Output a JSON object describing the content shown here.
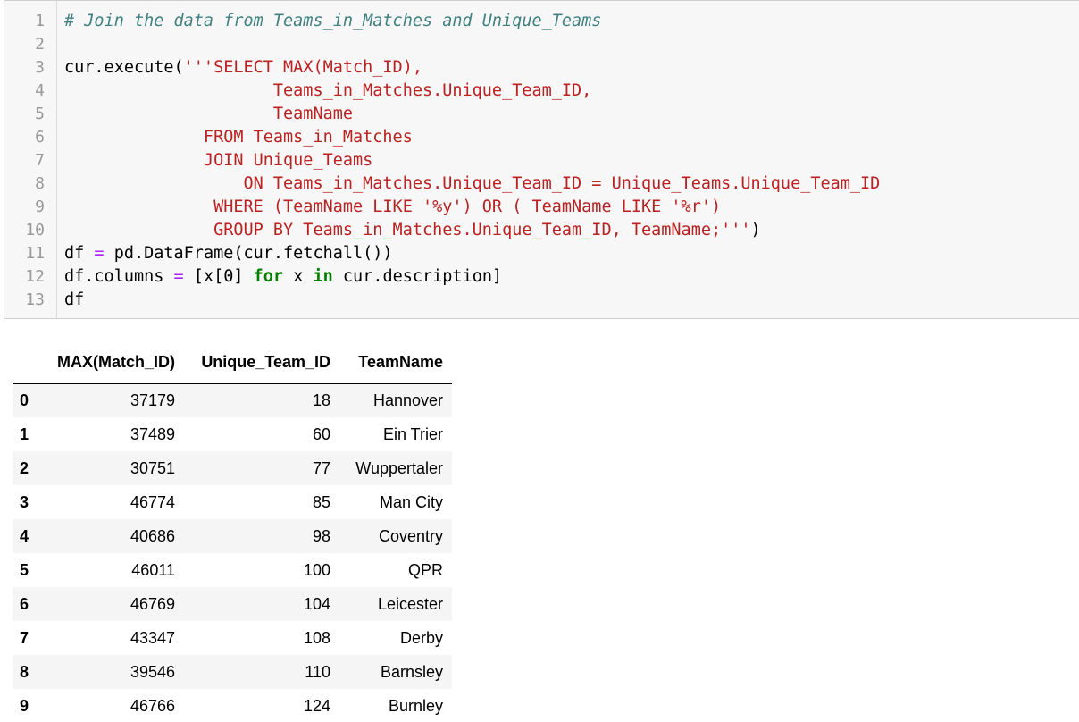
{
  "code_cell": {
    "line_numbers": [
      "1",
      "2",
      "3",
      "4",
      "5",
      "6",
      "7",
      "8",
      "9",
      "10",
      "11",
      "12",
      "13"
    ],
    "lines": [
      [
        {
          "t": "# Join the data from Teams_in_Matches and Unique_Teams",
          "c": "comment"
        }
      ],
      [],
      [
        {
          "t": "cur.execute(",
          "c": "plain"
        },
        {
          "t": "'''SELECT MAX(Match_ID),",
          "c": "str"
        }
      ],
      [
        {
          "t": "                     Teams_in_Matches.Unique_Team_ID,",
          "c": "str"
        }
      ],
      [
        {
          "t": "                     TeamName",
          "c": "str"
        }
      ],
      [
        {
          "t": "              FROM Teams_in_Matches",
          "c": "str"
        }
      ],
      [
        {
          "t": "              JOIN Unique_Teams",
          "c": "str"
        }
      ],
      [
        {
          "t": "                  ON Teams_in_Matches.Unique_Team_ID = Unique_Teams.Unique_Team_ID",
          "c": "str"
        }
      ],
      [
        {
          "t": "               WHERE (TeamName LIKE '%y') OR ( TeamName LIKE '%r')",
          "c": "str"
        }
      ],
      [
        {
          "t": "               GROUP BY Teams_in_Matches.Unique_Team_ID, TeamName;'''",
          "c": "str"
        },
        {
          "t": ")",
          "c": "plain"
        }
      ],
      [
        {
          "t": "df ",
          "c": "plain"
        },
        {
          "t": "=",
          "c": "op"
        },
        {
          "t": " pd.DataFrame(cur.fetchall())",
          "c": "plain"
        }
      ],
      [
        {
          "t": "df.columns ",
          "c": "plain"
        },
        {
          "t": "=",
          "c": "op"
        },
        {
          "t": " [x[",
          "c": "plain"
        },
        {
          "t": "0",
          "c": "num"
        },
        {
          "t": "] ",
          "c": "plain"
        },
        {
          "t": "for",
          "c": "kw"
        },
        {
          "t": " x ",
          "c": "plain"
        },
        {
          "t": "in",
          "c": "kw"
        },
        {
          "t": " cur.description]",
          "c": "plain"
        }
      ],
      [
        {
          "t": "df",
          "c": "plain"
        }
      ]
    ]
  },
  "output_table": {
    "columns": [
      "",
      "MAX(Match_ID)",
      "Unique_Team_ID",
      "TeamName"
    ],
    "rows": [
      {
        "index": "0",
        "max_match_id": "37179",
        "unique_team_id": "18",
        "team_name": "Hannover"
      },
      {
        "index": "1",
        "max_match_id": "37489",
        "unique_team_id": "60",
        "team_name": "Ein Trier"
      },
      {
        "index": "2",
        "max_match_id": "30751",
        "unique_team_id": "77",
        "team_name": "Wuppertaler"
      },
      {
        "index": "3",
        "max_match_id": "46774",
        "unique_team_id": "85",
        "team_name": "Man City"
      },
      {
        "index": "4",
        "max_match_id": "40686",
        "unique_team_id": "98",
        "team_name": "Coventry"
      },
      {
        "index": "5",
        "max_match_id": "46011",
        "unique_team_id": "100",
        "team_name": "QPR"
      },
      {
        "index": "6",
        "max_match_id": "46769",
        "unique_team_id": "104",
        "team_name": "Leicester"
      },
      {
        "index": "7",
        "max_match_id": "43347",
        "unique_team_id": "108",
        "team_name": "Derby"
      },
      {
        "index": "8",
        "max_match_id": "39546",
        "unique_team_id": "110",
        "team_name": "Barnsley"
      },
      {
        "index": "9",
        "max_match_id": "46766",
        "unique_team_id": "124",
        "team_name": "Burnley"
      }
    ]
  },
  "colors": {
    "comment": "#408080",
    "string": "#ba2121",
    "operator": "#aa22ff",
    "keyword": "#008000",
    "cell_background": "#f7f7f7",
    "row_stripe": "#f5f5f5"
  }
}
